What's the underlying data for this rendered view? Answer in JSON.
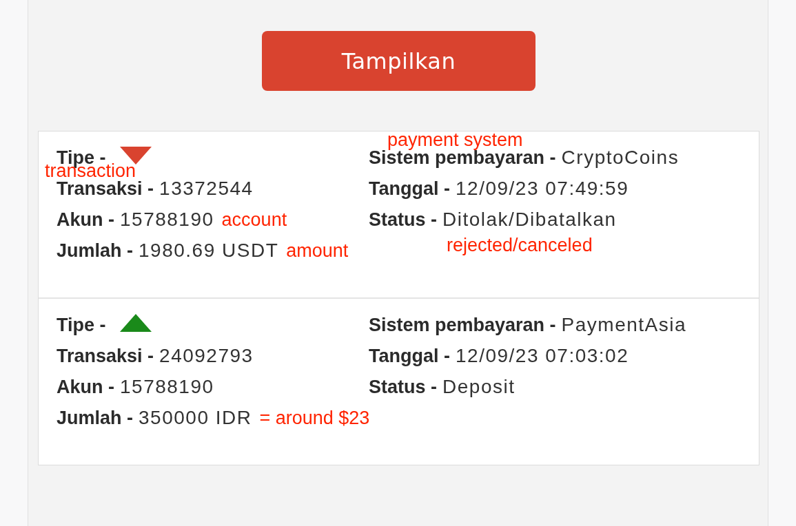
{
  "show_button": {
    "label": "Tampilkan"
  },
  "transactions": [
    {
      "left": [
        {
          "kind": "marker",
          "label": "Tipe -",
          "marker": {
            "kind": "down",
            "color": "#d9432f"
          }
        },
        {
          "kind": "text",
          "label": "Transaksi -",
          "value": "13372544",
          "note": {
            "text": "transaction",
            "kind": "above"
          }
        },
        {
          "kind": "text",
          "label": "Akun -",
          "value": "15788190",
          "note": {
            "text": "account",
            "kind": "after"
          }
        },
        {
          "kind": "text",
          "label": "Jumlah -",
          "value": "1980.69 USDT",
          "note": {
            "text": "amount",
            "kind": "after"
          }
        }
      ],
      "right": [
        {
          "kind": "text",
          "label": "Sistem pembayaran -",
          "value": "CryptoCoins",
          "note": {
            "text": "payment system",
            "kind": "above"
          }
        },
        {
          "kind": "text",
          "label": "Tanggal -",
          "value": "12/09/23 07:49:59"
        },
        {
          "kind": "text",
          "label": "Status -",
          "value": "Ditolak/Dibatalkan",
          "note": {
            "text": "rejected/canceled",
            "kind": "below"
          }
        }
      ]
    },
    {
      "left": [
        {
          "kind": "marker",
          "label": "Tipe -",
          "marker": {
            "kind": "up",
            "color": "#1a8a1a"
          }
        },
        {
          "kind": "text",
          "label": "Transaksi -",
          "value": "24092793"
        },
        {
          "kind": "text",
          "label": "Akun -",
          "value": "15788190"
        },
        {
          "kind": "text",
          "label": "Jumlah -",
          "value": "350000 IDR",
          "note": {
            "text": "= around $23",
            "kind": "after"
          }
        }
      ],
      "right": [
        {
          "kind": "text",
          "label": "Sistem pembayaran -",
          "value": "PaymentAsia"
        },
        {
          "kind": "text",
          "label": "Tanggal -",
          "value": "12/09/23 07:03:02"
        },
        {
          "kind": "text",
          "label": "Status -",
          "value": "Deposit"
        }
      ]
    }
  ]
}
